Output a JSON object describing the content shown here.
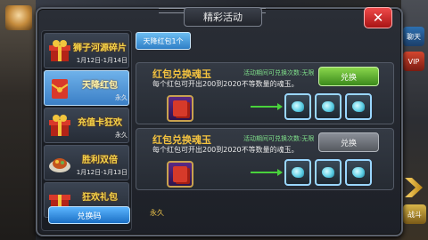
{
  "window": {
    "title": "精彩活动",
    "close_label": "✕"
  },
  "side": {
    "chat": "聊天",
    "vip": "VIP",
    "fight": "战斗"
  },
  "tabs": [
    {
      "name": "狮子河源碎片",
      "date": "1月12日-1月14日",
      "active": false
    },
    {
      "name": "天降红包",
      "date": "永久",
      "active": true
    },
    {
      "name": "充值卡狂欢",
      "date": "永久",
      "active": false
    },
    {
      "name": "胜利双倍",
      "date": "1月12日-1月13日",
      "active": false
    },
    {
      "name": "狂欢礼包",
      "date": "",
      "active": false
    }
  ],
  "redeem_code_label": "兑换码",
  "content": {
    "subtab_label": "天降红包1个",
    "cards": [
      {
        "title": "红包兑换魂玉",
        "limit": "活动期间可兑换次数:无限",
        "desc": "每个红包可开出200到2020不等数量的魂玉。",
        "button": "兑换",
        "button_enabled": true
      },
      {
        "title": "红包兑换魂玉",
        "limit": "活动期间可兑换次数:无限",
        "desc": "每个红包可开出200到2020不等数量的魂玉。",
        "button": "兑换",
        "button_enabled": false
      }
    ],
    "duration_label": "永久"
  },
  "colors": {
    "accent": "#3b7fc6",
    "title_gold": "#f3c23f",
    "limit_green": "#7fe08a"
  }
}
